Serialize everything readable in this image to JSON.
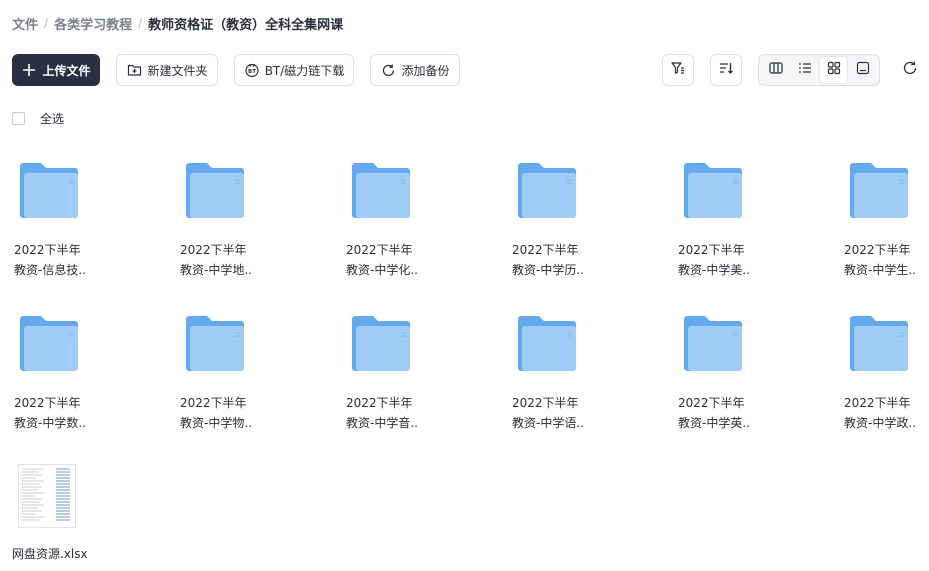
{
  "breadcrumb": {
    "items": [
      "文件",
      "各类学习教程",
      "教师资格证（教资）全科全集网课"
    ],
    "separator": "/"
  },
  "toolbar": {
    "upload_label": "上传文件",
    "new_folder_label": "新建文件夹",
    "bt_label": "BT/磁力链下载",
    "backup_label": "添加备份"
  },
  "select_all_label": "全选",
  "colors": {
    "primary_button": "#2c2f44",
    "folder_back": "#64a8ee",
    "folder_front": "#9fcdf8"
  },
  "folders": [
    {
      "line1": "2022下半年",
      "line2": "教资-信息技.."
    },
    {
      "line1": "2022下半年",
      "line2": "教资-中学地.."
    },
    {
      "line1": "2022下半年",
      "line2": "教资-中学化.."
    },
    {
      "line1": "2022下半年",
      "line2": "教资-中学历.."
    },
    {
      "line1": "2022下半年",
      "line2": "教资-中学美.."
    },
    {
      "line1": "2022下半年",
      "line2": "教资-中学生.."
    },
    {
      "line1": "2022下半年",
      "line2": "教资-中学数.."
    },
    {
      "line1": "2022下半年",
      "line2": "教资-中学物.."
    },
    {
      "line1": "2022下半年",
      "line2": "教资-中学音.."
    },
    {
      "line1": "2022下半年",
      "line2": "教资-中学语.."
    },
    {
      "line1": "2022下半年",
      "line2": "教资-中学英.."
    },
    {
      "line1": "2022下半年",
      "line2": "教资-中学政.."
    }
  ],
  "files": [
    {
      "name": "网盘资源.xlsx",
      "icon": "spreadsheet-thumbnail"
    }
  ]
}
